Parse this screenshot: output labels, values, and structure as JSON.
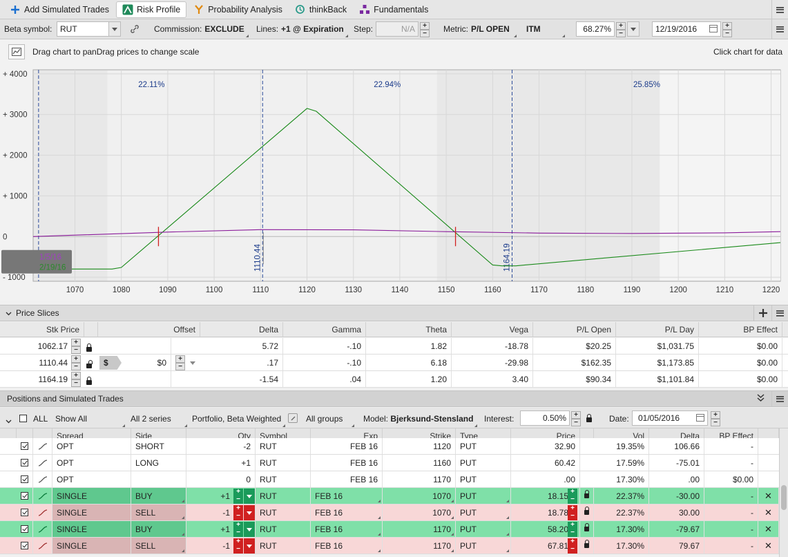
{
  "tabs": [
    {
      "label": "Add Simulated Trades",
      "icon": "plus-icon"
    },
    {
      "label": "Risk Profile",
      "icon": "risk-profile-icon",
      "active": true
    },
    {
      "label": "Probability Analysis",
      "icon": "probability-icon"
    },
    {
      "label": "thinkBack",
      "icon": "thinkback-icon"
    },
    {
      "label": "Fundamentals",
      "icon": "fundamentals-icon"
    }
  ],
  "settings": {
    "beta_label": "Beta symbol:",
    "beta_value": "RUT",
    "commission_label": "Commission:",
    "commission_value": "EXCLUDE",
    "lines_label": "Lines:",
    "lines_value": "+1 @ Expiration",
    "step_label": "Step:",
    "step_value": "N/A",
    "metric_label": "Metric:",
    "metric_value": "P/L OPEN",
    "itm": "ITM",
    "pct_value": "68.27%",
    "date_value": "12/19/2016"
  },
  "chart_toolbar": {
    "hint": "Drag chart to panDrag prices to change scale",
    "right_hint": "Click chart for data"
  },
  "chart_data": {
    "type": "line",
    "xlim": [
      1061,
      1222
    ],
    "ylim": [
      -1100,
      4100
    ],
    "x_ticks": [
      1070,
      1080,
      1090,
      1100,
      1110,
      1120,
      1130,
      1140,
      1150,
      1160,
      1170,
      1180,
      1190,
      1200,
      1210,
      1220
    ],
    "y_ticks": [
      {
        "v": 4000,
        "label": "+ 4000"
      },
      {
        "v": 3000,
        "label": "+ 3000"
      },
      {
        "v": 2000,
        "label": "+ 2000"
      },
      {
        "v": 1000,
        "label": "+ 1000"
      },
      {
        "v": 0,
        "label": "0"
      },
      {
        "v": -1000,
        "label": "- 1000"
      }
    ],
    "series": [
      {
        "color": "#1a8a1a",
        "x": [
          1061,
          1078,
          1080,
          1120,
          1122,
          1160,
          1162,
          1165,
          1222
        ],
        "y": [
          -800,
          -800,
          -760,
          3150,
          3080,
          -700,
          -720,
          -720,
          -150
        ]
      },
      {
        "color": "#8a1a9a",
        "x": [
          1061,
          1090,
          1110,
          1130,
          1150,
          1170,
          1190,
          1210,
          1222
        ],
        "y": [
          0,
          110,
          170,
          165,
          120,
          85,
          75,
          90,
          120
        ]
      }
    ],
    "vlines": [
      {
        "x": 1062.17,
        "pct": ""
      },
      {
        "x": 1110.44,
        "pct": "22.11%",
        "pct_x": 1086.5,
        "label": "1110.44"
      },
      {
        "x": 1164.19,
        "pct": "22.94%",
        "pct_x": 1137.3,
        "label": "1164.19"
      },
      {
        "x": 1164.19,
        "pct": "25.85%",
        "pct_x": 1193.2,
        "label": ""
      }
    ],
    "breakevens": [
      1088,
      1152
    ],
    "shade": [
      {
        "from": 1077,
        "to": 1148
      },
      {
        "from": 1196,
        "to": 1222,
        "light": true
      }
    ],
    "date_tag_1": "1/5/16",
    "date_tag_2": "2/19/16"
  },
  "price_slices": {
    "title": "Price Slices",
    "columns": [
      "Stk Price",
      "Offset",
      "Delta",
      "Gamma",
      "Theta",
      "Vega",
      "P/L Open",
      "P/L Day",
      "BP Effect"
    ],
    "rows": [
      {
        "stk": "1062.17",
        "offset": "",
        "delta": "5.72",
        "gamma": "-.10",
        "theta": "1.82",
        "vega": "-18.78",
        "plopen": "$20.25",
        "plday": "$1,031.75",
        "bp": "$0.00"
      },
      {
        "stk": "1110.44",
        "offset": "$0",
        "delta": ".17",
        "gamma": "-.10",
        "theta": "6.18",
        "vega": "-29.98",
        "plopen": "$162.35",
        "plday": "$1,173.85",
        "bp": "$0.00"
      },
      {
        "stk": "1164.19",
        "offset": "",
        "delta": "-1.54",
        "gamma": ".04",
        "theta": "1.20",
        "vega": "3.40",
        "plopen": "$90.34",
        "plday": "$1,101.84",
        "bp": "$0.00"
      }
    ]
  },
  "positions": {
    "title": "Positions and Simulated Trades",
    "filter_all": "ALL",
    "show_all": "Show All",
    "series": "All 2 series",
    "portfolio": "Portfolio, Beta Weighted",
    "groups": "All groups",
    "model_label": "Model:",
    "model_value": "Bjerksund-Stensland",
    "interest_label": "Interest:",
    "interest_value": "0.50%",
    "date_label": "Date:",
    "date_value": "01/05/2016",
    "columns": [
      "Spread",
      "Side",
      "Qty",
      "Symbol",
      "Exp",
      "Strike",
      "Type",
      "Price",
      "Vol",
      "Delta",
      "BP Effect"
    ],
    "rows": [
      {
        "spread": "OPT",
        "side": "SHORT",
        "qty": "-2",
        "symbol": "RUT",
        "exp": "FEB 16",
        "strike": "1120",
        "type": "PUT",
        "price": "32.90",
        "vol": "19.35%",
        "delta": "106.66",
        "bp": "-",
        "style": "plain"
      },
      {
        "spread": "OPT",
        "side": "LONG",
        "qty": "+1",
        "symbol": "RUT",
        "exp": "FEB 16",
        "strike": "1160",
        "type": "PUT",
        "price": "60.42",
        "vol": "17.59%",
        "delta": "-75.01",
        "bp": "-",
        "style": "plain"
      },
      {
        "spread": "OPT",
        "side": "",
        "qty": "0",
        "symbol": "RUT",
        "exp": "FEB 16",
        "strike": "1170",
        "type": "PUT",
        "price": ".00",
        "vol": "17.30%",
        "delta": ".00",
        "bp": "$0.00",
        "style": "plain"
      },
      {
        "spread": "SINGLE",
        "side": "BUY",
        "qty": "+1",
        "symbol": "RUT",
        "exp": "FEB 16",
        "strike": "1070",
        "type": "PUT",
        "price": "18.15",
        "vol": "22.37%",
        "delta": "-30.00",
        "bp": "-",
        "style": "buy"
      },
      {
        "spread": "SINGLE",
        "side": "SELL",
        "qty": "-1",
        "symbol": "RUT",
        "exp": "FEB 16",
        "strike": "1070",
        "type": "PUT",
        "price": "18.78",
        "vol": "22.37%",
        "delta": "30.00",
        "bp": "-",
        "style": "sell"
      },
      {
        "spread": "SINGLE",
        "side": "BUY",
        "qty": "+1",
        "symbol": "RUT",
        "exp": "FEB 16",
        "strike": "1170",
        "type": "PUT",
        "price": "58.20",
        "vol": "17.30%",
        "delta": "-79.67",
        "bp": "-",
        "style": "buy"
      },
      {
        "spread": "SINGLE",
        "side": "SELL",
        "qty": "-1",
        "symbol": "RUT",
        "exp": "FEB 16",
        "strike": "1170",
        "type": "PUT",
        "price": "67.81",
        "vol": "17.30%",
        "delta": "79.67",
        "bp": "-",
        "style": "sell"
      }
    ]
  }
}
